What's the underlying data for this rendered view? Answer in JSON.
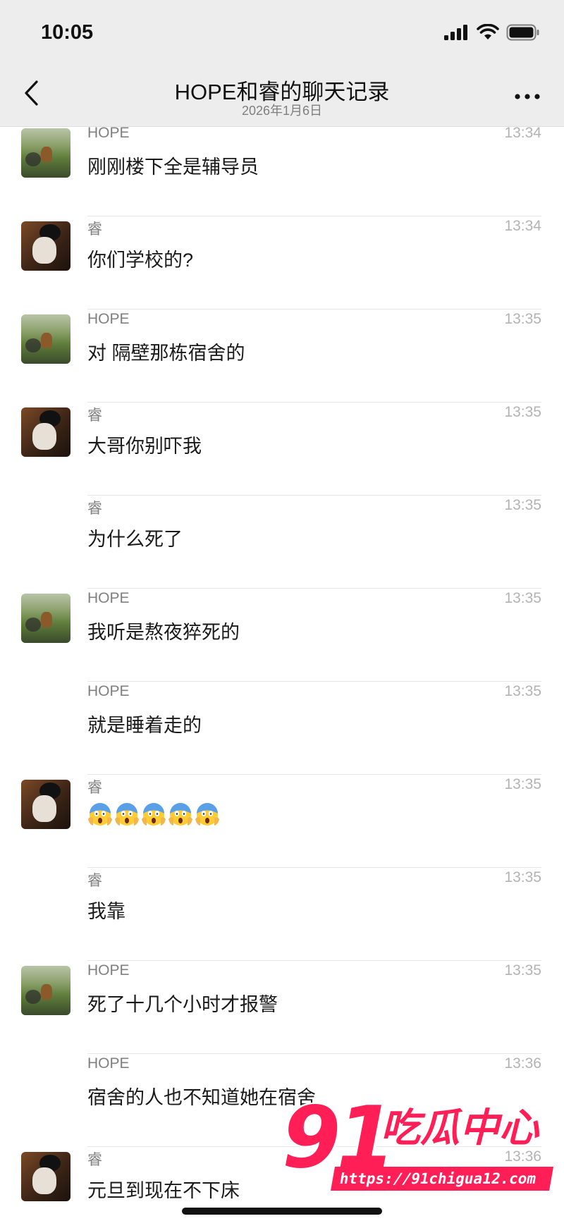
{
  "status_bar": {
    "time": "10:05"
  },
  "header": {
    "title": "HOPE和睿的聊天记录",
    "subtitle": "2026年1月6日"
  },
  "messages": [
    {
      "sender": "HOPE",
      "time": "13:34",
      "text": "刚刚楼下全是辅导员",
      "avatar": "hope"
    },
    {
      "sender": "睿",
      "time": "13:34",
      "text": "你们学校的?",
      "avatar": "rui"
    },
    {
      "sender": "HOPE",
      "time": "13:35",
      "text": "对 隔壁那栋宿舍的",
      "avatar": "hope"
    },
    {
      "sender": "睿",
      "time": "13:35",
      "text": "大哥你别吓我",
      "avatar": "rui"
    },
    {
      "sender": "睿",
      "time": "13:35",
      "text": "为什么死了",
      "avatar": ""
    },
    {
      "sender": "HOPE",
      "time": "13:35",
      "text": "我听是熬夜猝死的",
      "avatar": "hope"
    },
    {
      "sender": "HOPE",
      "time": "13:35",
      "text": "就是睡着走的",
      "avatar": ""
    },
    {
      "sender": "睿",
      "time": "13:35",
      "text": "",
      "emoji": "screaming-face",
      "emoji_count": 5,
      "avatar": "rui"
    },
    {
      "sender": "睿",
      "time": "13:35",
      "text": "我靠",
      "avatar": ""
    },
    {
      "sender": "HOPE",
      "time": "13:35",
      "text": "死了十几个小时才报警",
      "avatar": "hope"
    },
    {
      "sender": "HOPE",
      "time": "13:36",
      "text": "宿舍的人也不知道她在宿舍",
      "avatar": ""
    },
    {
      "sender": "睿",
      "time": "13:36",
      "text": "元旦到现在不下床",
      "avatar": "rui"
    }
  ],
  "watermark": {
    "number": "91",
    "name": "吃瓜中心",
    "url": "https://91chigua12.com"
  },
  "colors": {
    "header_bg": "#ededed",
    "watermark_red": "#ff1f56"
  }
}
